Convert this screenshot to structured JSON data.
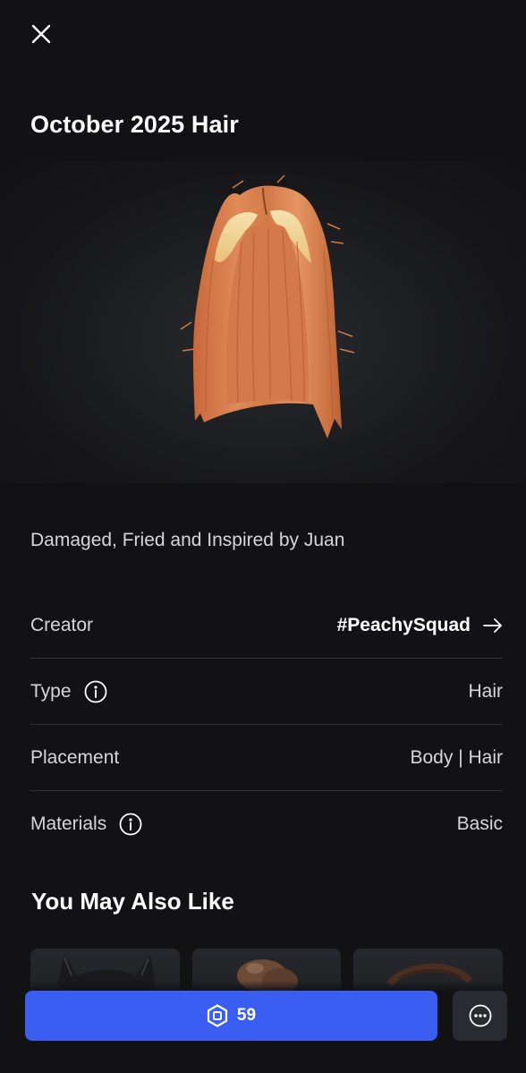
{
  "item": {
    "title": "October 2025 Hair",
    "description": "Damaged, Fried and Inspired by Juan"
  },
  "details": {
    "creator_label": "Creator",
    "creator_value": "#PeachySquad",
    "type_label": "Type",
    "type_value": "Hair",
    "placement_label": "Placement",
    "placement_value": "Body | Hair",
    "materials_label": "Materials",
    "materials_value": "Basic"
  },
  "recommendations": {
    "title": "You May Also Like"
  },
  "purchase": {
    "price": "59",
    "currency_icon": "robux-icon"
  },
  "icons": {
    "close": "close-icon",
    "arrow": "arrow-right-icon",
    "info": "info-icon",
    "more": "more-options-icon"
  },
  "colors": {
    "background": "#121215",
    "accent": "#3a5df2",
    "hair_main": "#d9824f",
    "hair_highlight": "#f2d79a"
  }
}
